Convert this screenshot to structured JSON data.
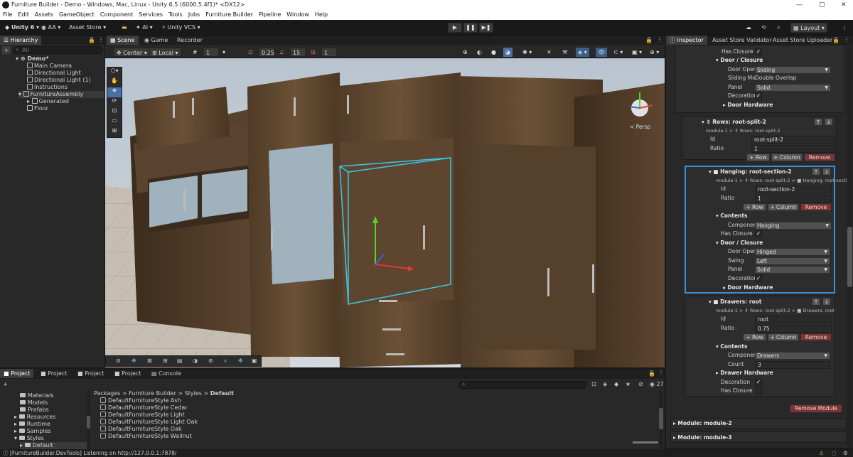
{
  "window": {
    "title": "Furniture Builder - Demo - Windows, Mac, Linux - Unity 6.5 (6000.5.4f1)* <DX12>",
    "controls": [
      "—",
      "▢",
      "✕"
    ]
  },
  "menu": [
    "File",
    "Edit",
    "Assets",
    "GameObject",
    "Component",
    "Services",
    "Tools",
    "Jobs",
    "Furniture Builder",
    "Pipeline",
    "Window",
    "Help"
  ],
  "toolbar": {
    "unity": "Unity 6",
    "account": "AA",
    "asset_store": "Asset Store",
    "ai": "AI",
    "vcs": "Unity VCS",
    "play": "▶",
    "pause": "❚❚",
    "step": "▶❚",
    "layout": "Layout"
  },
  "hierarchy": {
    "tab": "Hierarchy",
    "search_placeholder": "All",
    "items": [
      {
        "label": "Demo*",
        "indent": 0
      },
      {
        "label": "Main Camera",
        "indent": 1
      },
      {
        "label": "Directional Light",
        "indent": 1
      },
      {
        "label": "Directional Light (1)",
        "indent": 1
      },
      {
        "label": "Instructions",
        "indent": 1
      },
      {
        "label": "FurnitureAssembly",
        "indent": 1
      },
      {
        "label": "Generated",
        "indent": 2
      },
      {
        "label": "Floor",
        "indent": 1
      }
    ]
  },
  "scene": {
    "tabs": [
      "Scene",
      "Game",
      "Recorder"
    ],
    "pivot": "Center",
    "space": "Local",
    "grid_value": "1",
    "snap_value": "0.25",
    "angle_value": "15",
    "scale_value": "1",
    "persp_label": "< Persp"
  },
  "project": {
    "tabs": [
      "Project",
      "Project",
      "Project",
      "Project",
      "Console"
    ],
    "breadcrumb": [
      "Packages",
      "Furniture Builder",
      "Styles",
      "Default"
    ],
    "folders": [
      "Materials",
      "Models",
      "Prefabs",
      "Resources",
      "Runtime",
      "Samples",
      "Styles",
      "Default"
    ],
    "assets": [
      "DefaultFurnitureStyle Ash",
      "DefaultFurnitureStyle Cedar",
      "DefaultFurnitureStyle Light",
      "DefaultFurnitureStyle Light Oak",
      "DefaultFurnitureStyle Oak",
      "DefaultFurnitureStyle Wallnut"
    ],
    "count": "27"
  },
  "status": "[FurnitureBuilder.DevTools] Listening on http://127.0.0.1:7878/",
  "inspector": {
    "tabs": [
      "Inspector",
      "Asset Store Validator",
      "Asset Store Uploader"
    ],
    "top": {
      "has_closure": "Has Closure",
      "door_closure": "Door / Closure",
      "door_open_label": "Door Open",
      "door_open_value": "Sliding",
      "sliding_label": "Sliding Mo",
      "sliding_value": "Double Overlap",
      "panel_label": "Panel",
      "panel_value": "Solid",
      "decoration": "Decoration",
      "door_hardware": "Door Hardware"
    },
    "rows": {
      "title": "Rows: root-split-2",
      "path": "module-1 > ⇕ Rows: root-split-2",
      "id_label": "Id",
      "id_value": "root-split-2",
      "ratio_label": "Ratio",
      "ratio_value": "1",
      "add_row": "+ Row",
      "add_col": "+ Column",
      "remove": "Remove"
    },
    "hanging": {
      "title": "Hanging: root-section-2",
      "path": "module-1 > ⇕ Rows: root-split-2 > ■ Hanging: root-secti",
      "id_label": "Id",
      "id_value": "root-section-2",
      "ratio_label": "Ratio",
      "ratio_value": "1",
      "add_row": "+ Row",
      "add_col": "+ Column",
      "remove": "Remove",
      "contents": "Contents",
      "component_label": "Componen",
      "component_value": "Hanging",
      "has_closure": "Has Closure",
      "door_closure": "Door / Closure",
      "door_open_label": "Door Open",
      "door_open_value": "Hinged",
      "swing_label": "Swing",
      "swing_value": "Left",
      "panel_label": "Panel",
      "panel_value": "Solid",
      "decoration": "Decoration",
      "door_hardware": "Door Hardware"
    },
    "drawers": {
      "title": "Drawers: root",
      "path": "module-1 > ⇕ Rows: root-split-2 > ■ Drawers: root",
      "id_label": "Id",
      "id_value": "root",
      "ratio_label": "Ratio",
      "ratio_value": "0.75",
      "add_row": "+ Row",
      "add_col": "+ Column",
      "remove": "Remove",
      "contents": "Contents",
      "component_label": "Componen",
      "component_value": "Drawers",
      "count_label": "Count",
      "count_value": "3",
      "drawer_hardware": "Drawer Hardware",
      "decoration": "Decoration",
      "has_closure": "Has Closure"
    },
    "remove_module": "Remove Module",
    "module2": "Module: module-2",
    "module3": "Module: module-3"
  }
}
